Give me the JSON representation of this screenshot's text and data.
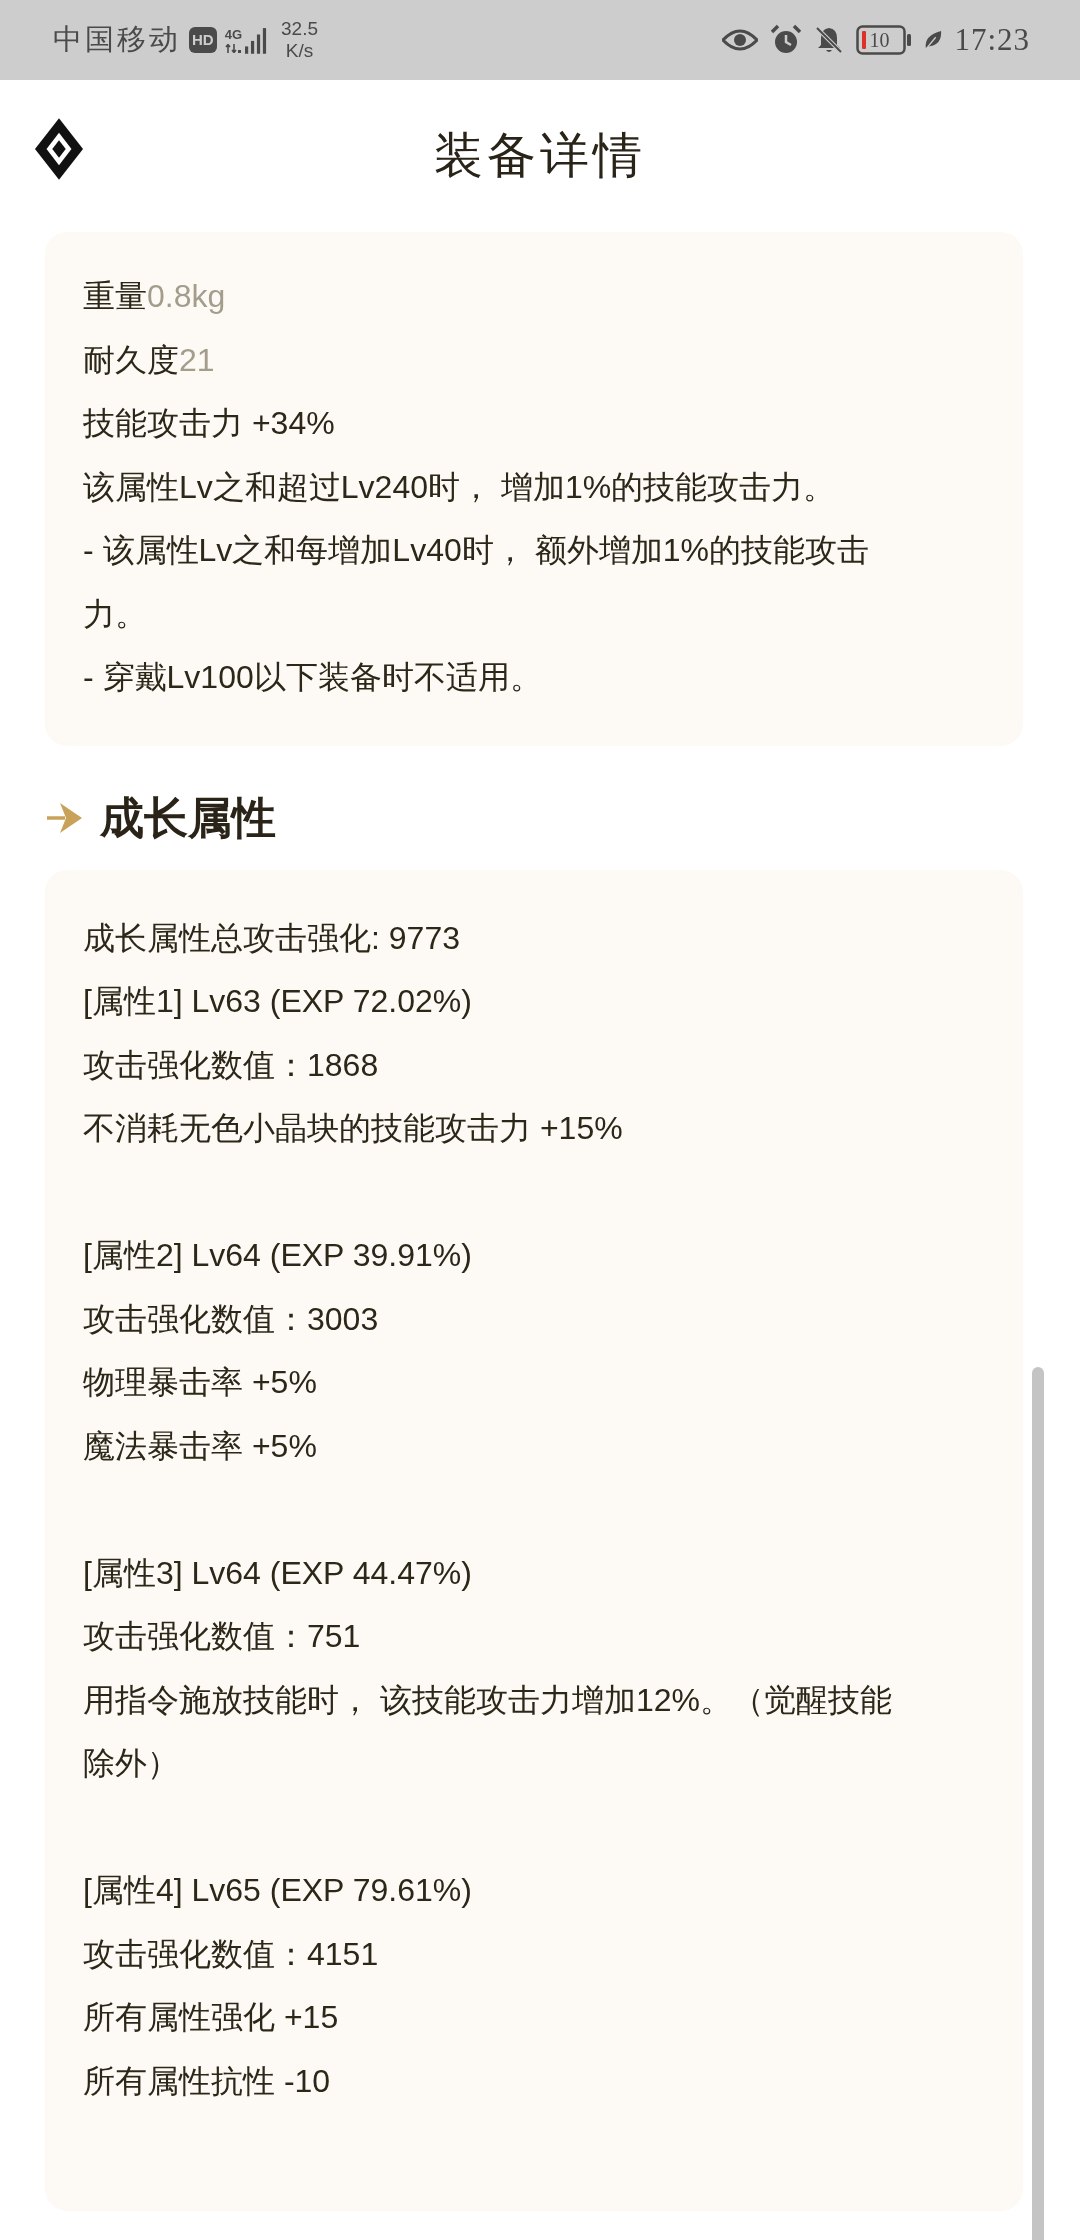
{
  "status_bar": {
    "carrier": "中国移动",
    "hd_badge": "HD",
    "network_type": "4G",
    "speed_value": "32.5",
    "speed_unit": "K/s",
    "battery_text": "10",
    "time": "17:23"
  },
  "header": {
    "title": "装备详情"
  },
  "details_card": {
    "lines": [
      {
        "kind": "field",
        "label": "重量",
        "value": "0.8kg"
      },
      {
        "kind": "field",
        "label": "耐久度",
        "value": "21"
      },
      {
        "kind": "text",
        "text": "技能攻击力 +34%"
      },
      {
        "kind": "text",
        "text": "该属性Lv之和超过Lv240时， 增加1%的技能攻击力。"
      },
      {
        "kind": "text",
        "text": "- 该属性Lv之和每增加Lv40时， 额外增加1%的技能攻击力。"
      },
      {
        "kind": "text",
        "text": "- 穿戴Lv100以下装备时不适用。"
      }
    ]
  },
  "growth_section": {
    "title": "成长属性",
    "groups": [
      {
        "lines": [
          "成长属性总攻击强化: 9773",
          "[属性1] Lv63 (EXP 72.02%)",
          "攻击强化数值：1868",
          "不消耗无色小晶块的技能攻击力 +15%"
        ]
      },
      {
        "lines": [
          "[属性2] Lv64 (EXP 39.91%)",
          "攻击强化数值：3003",
          "物理暴击率 +5%",
          "魔法暴击率 +5%"
        ]
      },
      {
        "lines": [
          "[属性3] Lv64 (EXP 44.47%)",
          "攻击强化数值：751",
          "用指令施放技能时， 该技能攻击力增加12%。（觉醒技能除外）"
        ]
      },
      {
        "lines": [
          "[属性4] Lv65 (EXP 79.61%)",
          "攻击强化数值：4151",
          "所有属性强化 +15",
          "所有属性抗性 -10"
        ]
      }
    ]
  }
}
